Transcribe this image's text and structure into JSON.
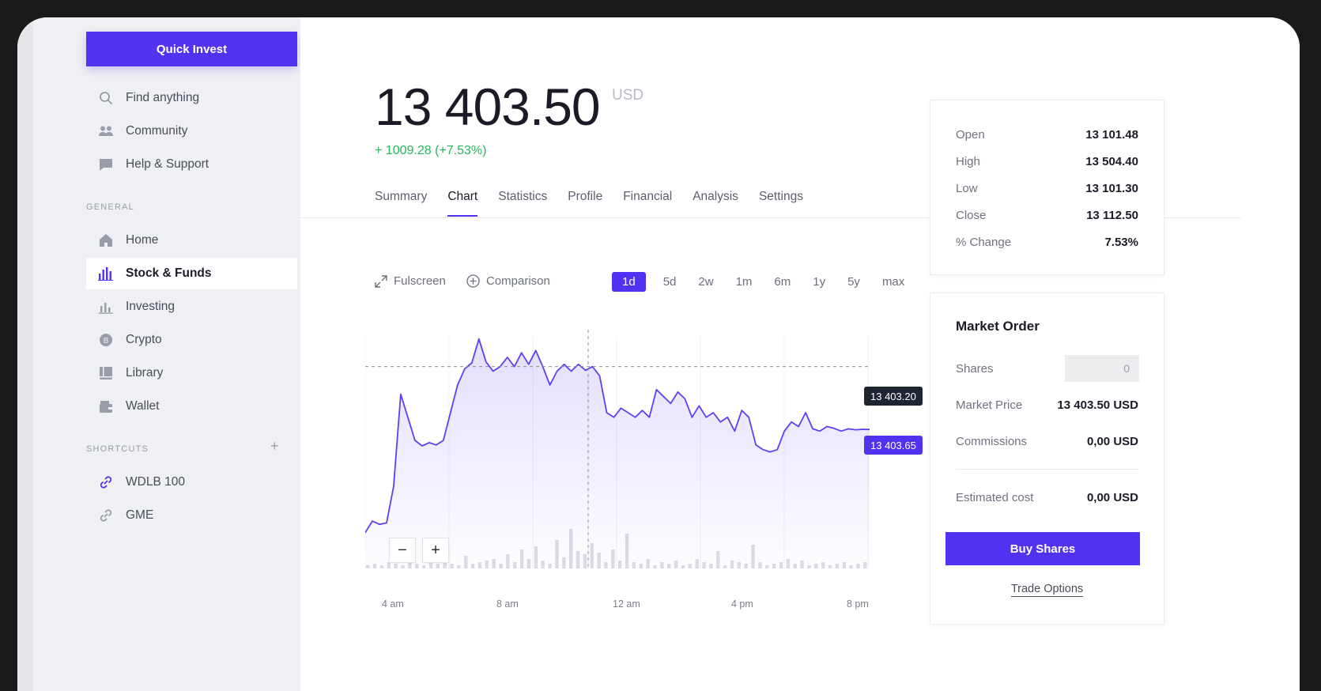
{
  "sidebar": {
    "quick_invest": "Quick Invest",
    "top_items": [
      {
        "label": "Find anything",
        "icon": "search-icon"
      },
      {
        "label": "Community",
        "icon": "users-icon"
      },
      {
        "label": "Help & Support",
        "icon": "chat-icon"
      }
    ],
    "general_label": "GENERAL",
    "general_items": [
      {
        "label": "Home",
        "icon": "home-icon"
      },
      {
        "label": "Stock & Funds",
        "icon": "bar-chart-icon",
        "active": true
      },
      {
        "label": "Investing",
        "icon": "investing-icon"
      },
      {
        "label": "Crypto",
        "icon": "coin-icon"
      },
      {
        "label": "Library",
        "icon": "book-icon"
      },
      {
        "label": "Wallet",
        "icon": "wallet-icon"
      }
    ],
    "shortcuts_label": "SHORTCUTS",
    "shortcuts_add": "+",
    "shortcuts": [
      {
        "label": "WDLB 100",
        "icon": "link-icon"
      },
      {
        "label": "GME",
        "icon": "link-icon"
      }
    ]
  },
  "quote": {
    "price": "13 403.50",
    "currency": "USD",
    "change": "+ 1009.28 (+7.53%)"
  },
  "tabs": [
    "Summary",
    "Chart",
    "Statistics",
    "Profile",
    "Financial",
    "Analysis",
    "Settings"
  ],
  "active_tab": "Chart",
  "toolbar": {
    "fullscreen": "Fulscreen",
    "comparison": "Comparison",
    "ranges": [
      "1d",
      "5d",
      "2w",
      "1m",
      "6m",
      "1y",
      "5y",
      "max"
    ],
    "active_range": "1d"
  },
  "chart_data": {
    "type": "area",
    "x_tick_labels": [
      "4 am",
      "8 am",
      "12 am",
      "4 pm",
      "8 pm"
    ],
    "crosshair_label": "13 403.20",
    "last_price_label": "13 403.65",
    "zoom_out": "−",
    "zoom_in": "+",
    "series": [
      {
        "values": [
          13080,
          13105,
          13098,
          13101,
          13180,
          13380,
          13330,
          13280,
          13268,
          13275,
          13270,
          13280,
          13340,
          13400,
          13435,
          13448,
          13500,
          13450,
          13430,
          13440,
          13460,
          13440,
          13470,
          13445,
          13475,
          13440,
          13400,
          13430,
          13445,
          13430,
          13445,
          13432,
          13440,
          13420,
          13340,
          13330,
          13350,
          13340,
          13330,
          13345,
          13330,
          13390,
          13375,
          13360,
          13385,
          13370,
          13330,
          13355,
          13330,
          13340,
          13320,
          13330,
          13300,
          13345,
          13330,
          13270,
          13260,
          13255,
          13260,
          13300,
          13320,
          13310,
          13340,
          13305,
          13300,
          13310,
          13306,
          13300,
          13305,
          13303,
          13304,
          13303.65
        ]
      },
      {
        "name": "volume",
        "values": [
          2,
          3,
          2,
          4,
          3,
          2,
          5,
          3,
          2,
          4,
          3,
          6,
          3,
          2,
          8,
          3,
          4,
          5,
          6,
          3,
          9,
          4,
          12,
          6,
          14,
          5,
          3,
          18,
          7,
          25,
          11,
          9,
          16,
          10,
          4,
          12,
          5,
          22,
          4,
          3,
          6,
          2,
          4,
          3,
          5,
          2,
          3,
          6,
          4,
          3,
          11,
          2,
          5,
          4,
          3,
          15,
          4,
          2,
          3,
          4,
          6,
          3,
          5,
          2,
          3,
          4,
          2,
          3,
          4,
          2,
          3,
          4
        ]
      }
    ]
  },
  "stats": [
    {
      "label": "Open",
      "value": "13 101.48"
    },
    {
      "label": "High",
      "value": "13 504.40"
    },
    {
      "label": "Low",
      "value": "13 101.30"
    },
    {
      "label": "Close",
      "value": "13 112.50"
    },
    {
      "label": "% Change",
      "value": "7.53%"
    }
  ],
  "order": {
    "title": "Market Order",
    "shares_label": "Shares",
    "shares_value": "0",
    "market_price_label": "Market Price",
    "market_price_value": "13 403.50 USD",
    "commissions_label": "Commissions",
    "commissions_value": "0,00 USD",
    "estimated_label": "Estimated cost",
    "estimated_value": "0,00 USD",
    "buy_label": "Buy Shares",
    "trade_options": "Trade Options"
  },
  "colors": {
    "accent": "#5331f1",
    "positive": "#22b85a",
    "tag_dark": "#1f2433"
  }
}
